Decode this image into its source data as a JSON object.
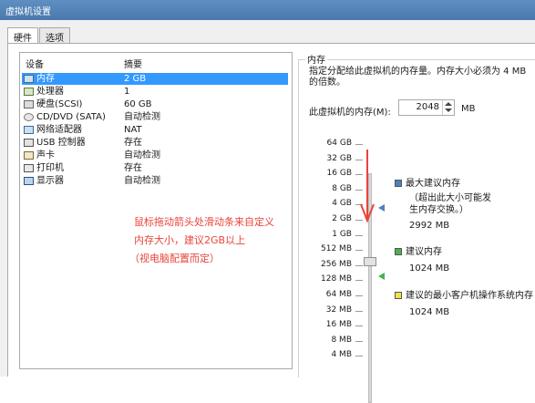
{
  "window": {
    "title": "虚拟机设置"
  },
  "tabs": [
    {
      "label": "硬件"
    },
    {
      "label": "选项"
    }
  ],
  "devices": {
    "headers": {
      "device": "设备",
      "summary": "摘要"
    },
    "rows": [
      {
        "name": "内存",
        "summary": "2 GB",
        "icon": "memory-icon"
      },
      {
        "name": "处理器",
        "summary": "1",
        "icon": "processor-icon"
      },
      {
        "name": "硬盘(SCSI)",
        "summary": "60 GB",
        "icon": "harddisk-icon"
      },
      {
        "name": "CD/DVD (SATA)",
        "summary": "自动检测",
        "icon": "cd-dvd-icon"
      },
      {
        "name": "网络适配器",
        "summary": "NAT",
        "icon": "network-adapter-icon"
      },
      {
        "name": "USB 控制器",
        "summary": "存在",
        "icon": "usb-controller-icon"
      },
      {
        "name": "声卡",
        "summary": "自动检测",
        "icon": "sound-card-icon"
      },
      {
        "name": "打印机",
        "summary": "存在",
        "icon": "printer-icon"
      },
      {
        "name": "显示器",
        "summary": "自动检测",
        "icon": "display-icon"
      }
    ]
  },
  "annotation": {
    "line1": "鼠标拖动箭头处滑动条来自定义",
    "line2": "内存大小，建议2GB以上",
    "line3": "（视电脑配置而定）"
  },
  "memory": {
    "group_title": "内存",
    "description": "指定分配给此虚拟机的内存量。内存大小必须为 4 MB 的倍数。",
    "field_label": "此虚拟机的内存(M):",
    "value": "2048",
    "unit": "MB",
    "scale": [
      "64 GB",
      "32 GB",
      "16 GB",
      "8 GB",
      "4 GB",
      "2 GB",
      "1 GB",
      "512 MB",
      "256 MB",
      "128 MB",
      "64 MB",
      "32 MB",
      "16 MB",
      "8 MB",
      "4 MB"
    ],
    "legend": {
      "max_recommended": {
        "label": "最大建议内存",
        "note": "（超出此大小可能发生内存交换。）",
        "value": "2992 MB",
        "color": "#4f81bd"
      },
      "recommended": {
        "label": "建议内存",
        "value": "1024 MB",
        "color": "#4caf50"
      },
      "min_recommended": {
        "label": "建议的最小客户机操作系统内存",
        "value": "1024 MB",
        "color": "#f2e24a"
      }
    }
  }
}
